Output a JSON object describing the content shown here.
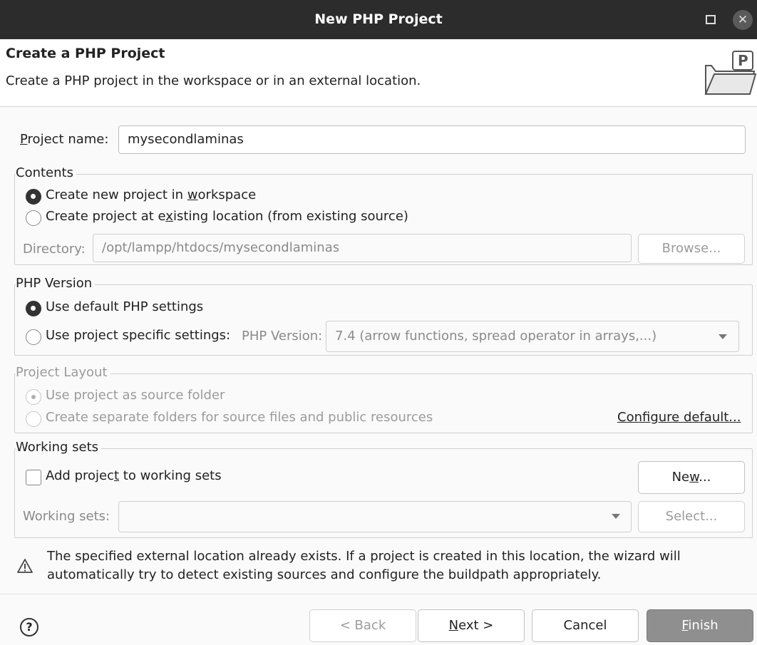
{
  "window": {
    "title": "New PHP Project",
    "maximize_icon": "maximize-icon",
    "close_icon": "close-icon",
    "close_glyph": "✕"
  },
  "header": {
    "title": "Create a PHP Project",
    "description": "Create a PHP project in the workspace or in an external location.",
    "icon": "php-folder-icon"
  },
  "project_name": {
    "label_mnemonic": "P",
    "label_rest": "roject name:",
    "value": "mysecondlaminas"
  },
  "contents": {
    "title": "Contents",
    "option_new_pre": "Create new project in ",
    "option_new_mnemonic": "w",
    "option_new_post": "orkspace",
    "option_existing_pre": "Create project at e",
    "option_existing_mnemonic": "x",
    "option_existing_post": "isting location (from existing source)",
    "directory_label": "Directory:",
    "directory_value": "/opt/lampp/htdocs/mysecondlaminas",
    "browse_label": "Browse..."
  },
  "php_version": {
    "title": "PHP Version",
    "option_default": "Use default PHP settings",
    "option_specific": "Use project specific settings:",
    "version_label": "PHP Version:",
    "version_value": "7.4 (arrow functions, spread operator in arrays,...)"
  },
  "project_layout": {
    "title": "Project Layout",
    "option_source": "Use project as source folder",
    "option_separate": "Create separate folders for source files and public resources",
    "configure_link": "Configure default..."
  },
  "working_sets": {
    "title": "Working sets",
    "add_pre": "Add projec",
    "add_mnemonic": "t",
    "add_post": " to working sets",
    "new_pre": "Ne",
    "new_mnemonic": "w",
    "new_post": "...",
    "sets_label": "Working sets:",
    "sets_value": "",
    "select_label": "Select..."
  },
  "warning": {
    "icon": "warning-icon",
    "line1": "The specified external location already exists. If a project is created in this location, the wizard will",
    "line2": "automatically try to detect existing sources and configure the buildpath appropriately."
  },
  "footer": {
    "help_glyph": "?",
    "back_label": "< Back",
    "next_mnemonic": "N",
    "next_rest": "ext >",
    "cancel_label": "Cancel",
    "finish_mnemonic": "F",
    "finish_rest": "inish"
  }
}
